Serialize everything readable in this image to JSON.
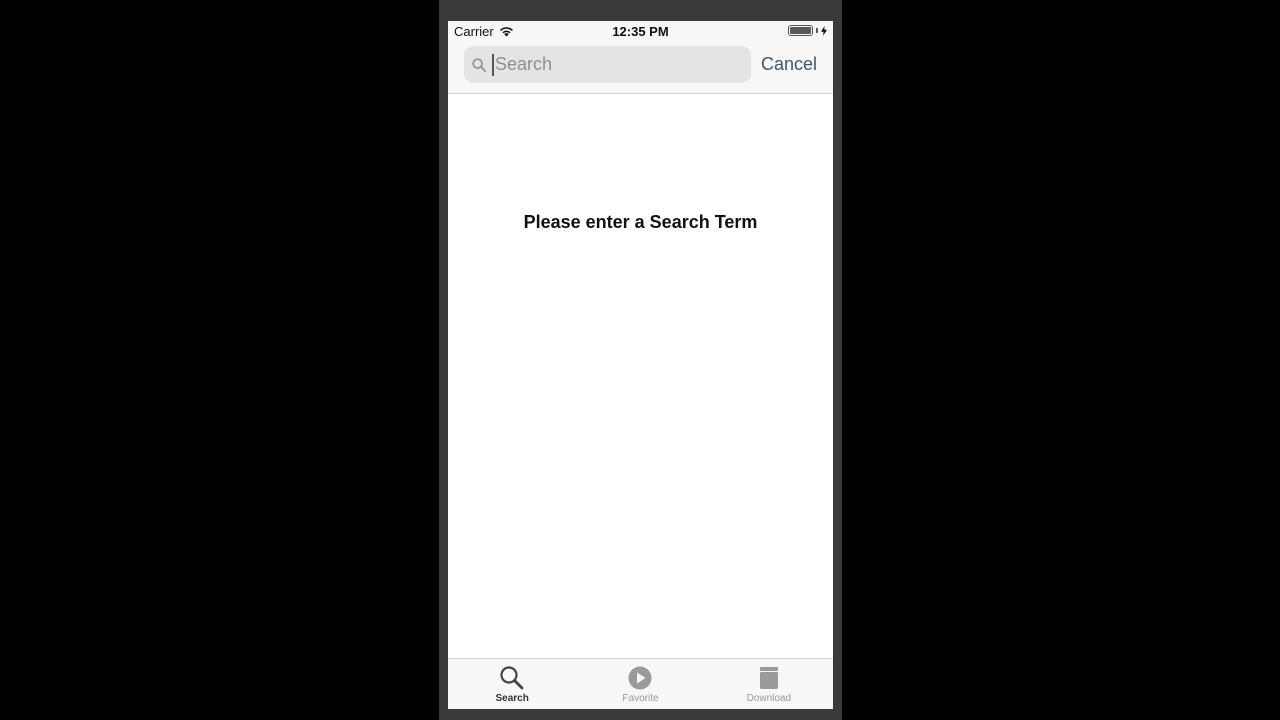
{
  "status_bar": {
    "carrier": "Carrier",
    "time": "12:35 PM",
    "battery_level": 1.0
  },
  "search": {
    "placeholder": "Search",
    "value": "",
    "cancel_label": "Cancel"
  },
  "content": {
    "empty_message": "Please enter a Search Term"
  },
  "tabs": [
    {
      "label": "Search",
      "icon": "magnifier-icon",
      "active": true
    },
    {
      "label": "Favorite",
      "icon": "play-circle-icon",
      "active": false
    },
    {
      "label": "Download",
      "icon": "archive-box-icon",
      "active": false
    }
  ],
  "colors": {
    "background": "#000000",
    "screen": "#ffffff",
    "bar_background": "#f7f7f7",
    "search_field": "#e4e4e4",
    "cancel_text": "#4a5560",
    "inactive_tab": "#999999"
  }
}
